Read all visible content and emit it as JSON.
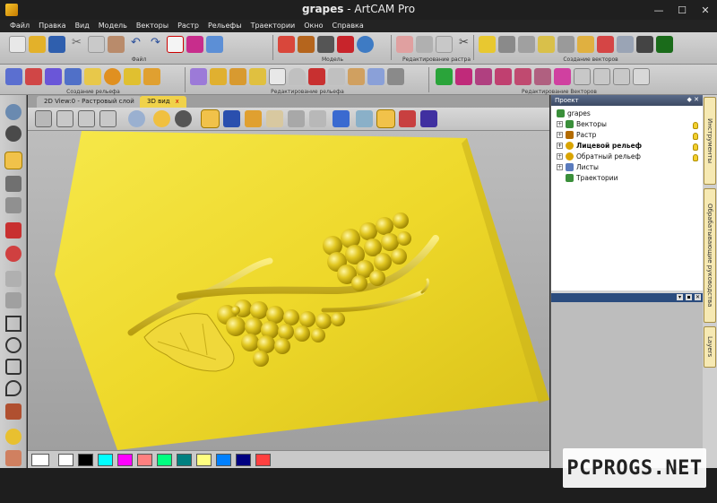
{
  "window": {
    "app_name": "grapes",
    "app_suffix": " - ArtCAM Pro"
  },
  "menu": [
    "Файл",
    "Правка",
    "Вид",
    "Модель",
    "Векторы",
    "Растр",
    "Рельефы",
    "Траектории",
    "Окно",
    "Справка"
  ],
  "toolbar_groups": {
    "file": "Файл",
    "model": "Модель",
    "raster_edit": "Редактирование растра",
    "vector_create": "Создание векторов",
    "relief_create": "Создание рельефа",
    "relief_edit": "Редактирование рельефа",
    "vector_edit": "Редактирование Векторов"
  },
  "tabs": {
    "view2d": "2D View:0 - Растровый слой",
    "view3d": "3D вид",
    "close": "x"
  },
  "project": {
    "title": "Проект",
    "root": "grapes",
    "items": [
      {
        "label": "Векторы",
        "color": "#3a8f3a"
      },
      {
        "label": "Растр",
        "color": "#b36b00"
      },
      {
        "label": "Лицевой рельеф",
        "color": "#d9a400",
        "bold": true
      },
      {
        "label": "Обратный рельеф",
        "color": "#d9a400"
      },
      {
        "label": "Листы",
        "color": "#5a7bbd"
      },
      {
        "label": "Траектории",
        "color": "#3a8f3a"
      }
    ]
  },
  "side_tabs": [
    "Инструменты",
    "Обрабатывающие руководства",
    "Layers"
  ],
  "swatches": [
    "#ffffff",
    "#000000",
    "#00ffff",
    "#ff00ff",
    "#ff8080",
    "#00ff80",
    "#008080",
    "#ffff80",
    "#0080ff",
    "#000080",
    "#ff4040"
  ],
  "watermark": "PCPROGS.NET",
  "colors": {
    "relief": "#f2de2c",
    "accent": "#f1c24a",
    "panel_head": "#2b4c7e"
  }
}
